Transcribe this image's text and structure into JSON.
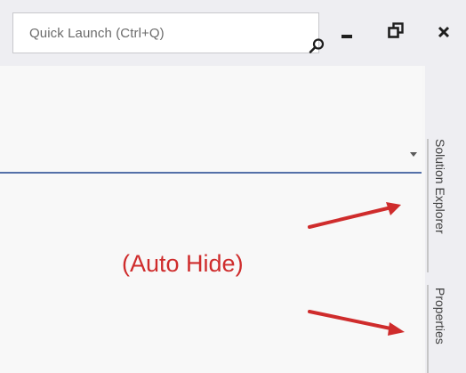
{
  "titlebar": {
    "quick_launch_placeholder": "Quick Launch (Ctrl+Q)",
    "icons": {
      "search": "search-icon",
      "minimize": "minimize-icon",
      "restore": "restore-icon",
      "close": "close-icon"
    }
  },
  "annotation": {
    "text": "(Auto Hide)",
    "color": "#cf2c2c"
  },
  "side_tabs": [
    {
      "label": "Solution Explorer"
    },
    {
      "label": "Properties"
    }
  ],
  "colors": {
    "accent_line": "#5470a8",
    "annotation": "#cf2c2c"
  }
}
